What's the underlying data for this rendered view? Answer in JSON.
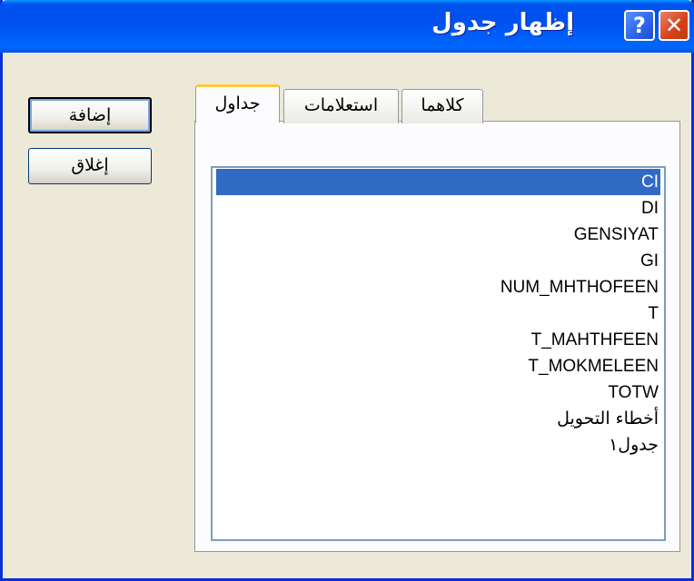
{
  "window": {
    "title": "إظهار جدول",
    "help_glyph": "?",
    "close_glyph": "✕"
  },
  "buttons": {
    "add_label": "إضافة",
    "close_label": "إغلاق"
  },
  "tabs": [
    {
      "label": "جداول",
      "selected": true
    },
    {
      "label": "استعلامات",
      "selected": false
    },
    {
      "label": "كلاهما",
      "selected": false
    }
  ],
  "list": {
    "selected_index": 0,
    "items": [
      "CI",
      "DI",
      "GENSIYAT",
      "GI",
      "NUM_MHTHOFEEN",
      "T",
      "T_MAHTHFEEN",
      "T_MOKMELEEN",
      "TOTW",
      "أخطاء التحويل",
      "جدول١"
    ]
  },
  "colors": {
    "title_bar": "#0058e6",
    "selection": "#316ac5",
    "dialog_bg": "#ece9d8"
  }
}
